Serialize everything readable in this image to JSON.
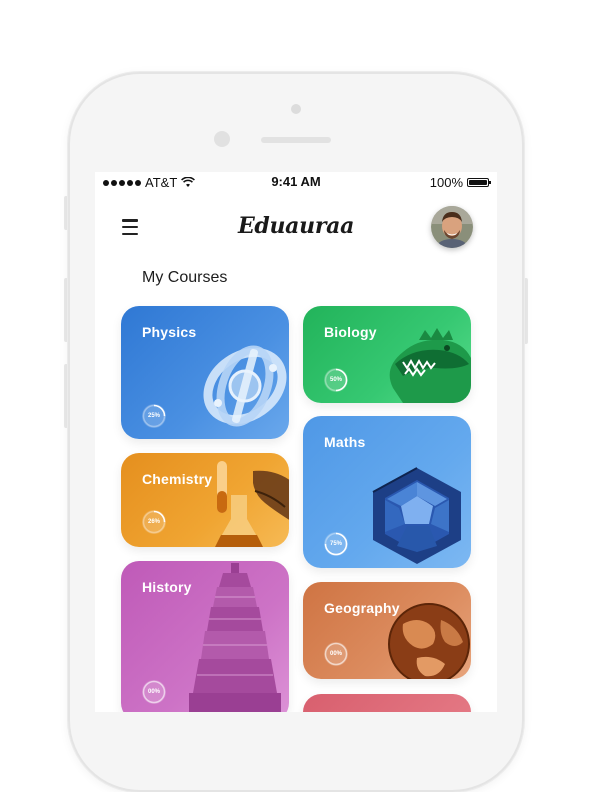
{
  "status_bar": {
    "carrier": "AT&T",
    "time": "9:41 AM",
    "battery": "100%"
  },
  "header": {
    "app_name": "Eduauraa"
  },
  "section_title": "My Courses",
  "courses": [
    {
      "name": "Physics",
      "progress": "25%",
      "progress_value": 0.25,
      "color": "#3a7fd8"
    },
    {
      "name": "Biology",
      "progress": "50%",
      "progress_value": 0.5,
      "color": "#2fc36b"
    },
    {
      "name": "Chemistry",
      "progress": "26%",
      "progress_value": 0.26,
      "color": "#f0a42c"
    },
    {
      "name": "Maths",
      "progress": "75%",
      "progress_value": 0.75,
      "color": "#5ba3ea"
    },
    {
      "name": "History",
      "progress": "00%",
      "progress_value": 0.0,
      "color": "#c76cc2"
    },
    {
      "name": "Geography",
      "progress": "00%",
      "progress_value": 0.0,
      "color": "#d98455"
    }
  ]
}
